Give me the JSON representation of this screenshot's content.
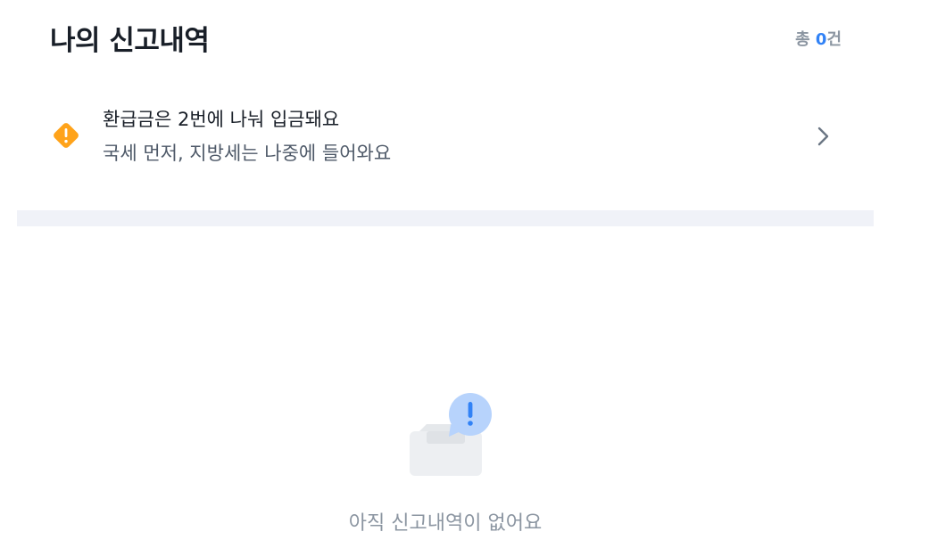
{
  "header": {
    "title": "나의 신고내역",
    "count_prefix": "총 ",
    "count_value": "0",
    "count_suffix": "건"
  },
  "notice": {
    "title": "환급금은 2번에 나눠 입금돼요",
    "description": "국세 먼저, 지방세는 나중에 들어와요",
    "icon": "warning-icon",
    "icon_color": "#ffa31a"
  },
  "empty_state": {
    "message": "아직 신고내역이 없어요",
    "icon": "empty-inbox-icon",
    "accent_color": "#b7d3fc"
  },
  "colors": {
    "accent": "#3182f6",
    "title_text": "#191f28",
    "muted_text": "#8b95a1",
    "divider": "#f0f2f8"
  }
}
